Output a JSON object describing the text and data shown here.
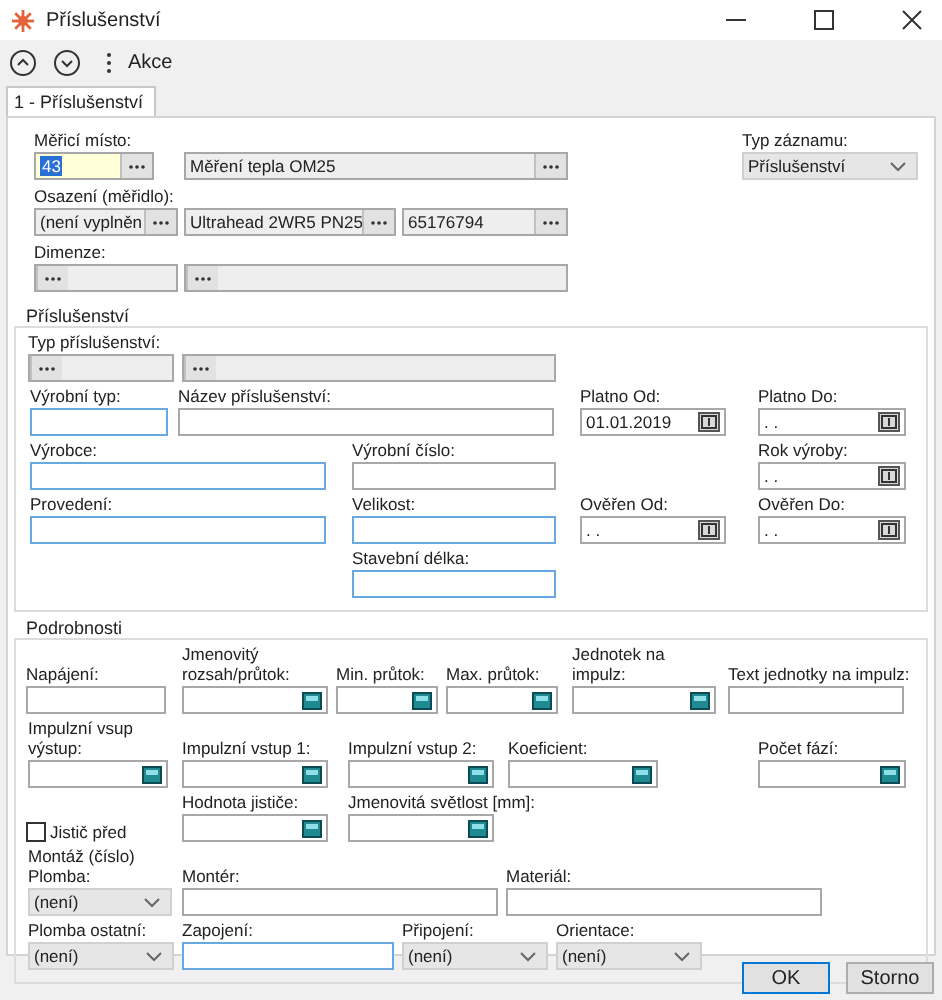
{
  "window": {
    "title": "Příslušenství"
  },
  "toolbar": {
    "actions_label": "Akce"
  },
  "tabs": [
    {
      "label": "1 - Příslušenství",
      "selected": true
    }
  ],
  "header": {
    "rows": [
      [
        {
          "kind": "lookup",
          "label": "Měřicí místo:",
          "value": "43",
          "focused": true
        },
        {
          "kind": "lookup",
          "value": "Měření tepla OM25",
          "focused": false
        },
        {
          "kind": "select",
          "label": "Typ záznamu:",
          "value": "Příslušenství"
        }
      ],
      [
        {
          "kind": "lookup",
          "label": "Osazení (měřidlo):",
          "value": "(není vyplněn",
          "focused": false
        },
        {
          "kind": "lookup",
          "value": "Ultrahead 2WR5 PN25",
          "focused": false
        },
        {
          "kind": "lookup",
          "value": "65176794",
          "focused": false
        }
      ],
      [
        {
          "kind": "lookup",
          "label": "Dimenze:",
          "focused": false
        },
        {
          "kind": "lookup",
          "focused": false
        }
      ]
    ]
  },
  "accessory": {
    "title": "Příslušenství",
    "rows": [
      [
        {
          "kind": "lookup",
          "label": "Typ příslušenství:",
          "focused": false
        },
        {
          "kind": "lookup",
          "focused": false
        }
      ],
      [
        {
          "kind": "text",
          "label": "Výrobní typ:",
          "highlighted": true
        },
        {
          "kind": "text",
          "label": "Název příslušenství:",
          "highlighted": false
        },
        {
          "kind": "date",
          "label": "Platno Od:",
          "value": "01.01.2019"
        },
        {
          "kind": "date",
          "label": "Platno Do:",
          "value": " . ."
        }
      ],
      [
        {
          "kind": "text",
          "label": "Výrobce:",
          "highlighted": true
        },
        {
          "kind": "text",
          "label": "Výrobní číslo:",
          "highlighted": false
        },
        {
          "kind": "spacer"
        },
        {
          "kind": "date",
          "label": "Rok výroby:",
          "value": " . ."
        }
      ],
      [
        {
          "kind": "text",
          "label": "Provedení:",
          "highlighted": true
        },
        {
          "kind": "text",
          "label": "Velikost:",
          "highlighted": true
        },
        {
          "kind": "date",
          "label": "Ověřen Od:",
          "value": " . ."
        },
        {
          "kind": "date",
          "label": "Ověřen Do:",
          "value": " . ."
        }
      ],
      [
        {
          "kind": "spacer"
        },
        {
          "kind": "text",
          "label": "Stavební délka:",
          "highlighted": true
        }
      ]
    ]
  },
  "details": {
    "title": "Podrobnosti",
    "rows": [
      [
        {
          "kind": "text",
          "label": "Napájení:",
          "highlighted": false
        },
        {
          "kind": "spin",
          "label": "Jmenovitý rozsah/průtok:"
        },
        {
          "kind": "spin",
          "label": "Min. průtok:"
        },
        {
          "kind": "spin",
          "label": "Max. průtok:"
        },
        {
          "kind": "spin",
          "label": "Jednotek na impulz:"
        },
        {
          "kind": "text",
          "label": "Text jednotky na impulz:",
          "highlighted": false
        }
      ],
      [
        {
          "kind": "spin",
          "label": "Impulzní vsup výstup:"
        },
        {
          "kind": "spin",
          "label": "Impulzní vstup 1:"
        },
        {
          "kind": "spin",
          "label": "Impulzní vstup 2:"
        },
        {
          "kind": "spin",
          "label": "Koeficient:"
        },
        {
          "kind": "spacer"
        },
        {
          "kind": "spin",
          "label": "Počet fází:"
        }
      ],
      [
        {
          "kind": "checkbox",
          "label": "Jistič před",
          "checked": false
        },
        {
          "kind": "spin",
          "label": "Hodnota jističe:"
        },
        {
          "kind": "spin",
          "label": "Jmenovitá světlost [mm]:"
        }
      ],
      [
        {
          "kind": "select",
          "label": "Plomba:",
          "overlay_label": "Montáž (číslo)",
          "value": "(není)"
        },
        {
          "kind": "text",
          "label": "Montér:",
          "highlighted": false
        },
        {
          "kind": "text",
          "label": "Materiál:",
          "highlighted": false
        }
      ],
      [
        {
          "kind": "select",
          "label": "Plomba ostatní:",
          "value": "(není)"
        },
        {
          "kind": "text",
          "label": "Zapojení:",
          "highlighted": true
        },
        {
          "kind": "select",
          "label": "Připojení:",
          "value": "(není)"
        },
        {
          "kind": "select",
          "label": "Orientace:",
          "value": "(není)"
        }
      ]
    ]
  },
  "buttons": [
    {
      "label": "OK",
      "selected": true
    },
    {
      "label": "Storno",
      "selected": false
    }
  ]
}
